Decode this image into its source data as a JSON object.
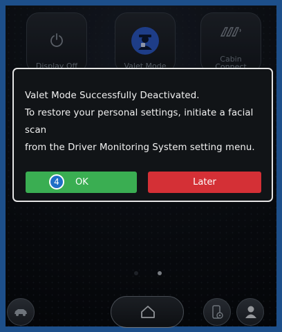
{
  "tiles": {
    "display_off": "Display Off",
    "valet_mode": "Valet Mode",
    "cabin_connect_line1": "Cabin",
    "cabin_connect_line2": "Connect"
  },
  "dialog": {
    "line1": "Valet Mode Successfully Deactivated.",
    "line2": "To restore your personal settings, initiate a facial scan",
    "line3": "from the Driver Monitoring System setting menu.",
    "ok_label": "OK",
    "later_label": "Later",
    "step_badge": "4"
  },
  "pager": {
    "pages": 2,
    "active_page": 2
  },
  "colors": {
    "frame_border": "#1d4f8a",
    "ok_button": "#3aae52",
    "later_button": "#d43036",
    "badge": "#1f6fc6",
    "valet_icon": "#2f5fd0"
  },
  "icons": {
    "display_off": "power-icon",
    "valet_mode": "valet-person-icon",
    "cabin_connect": "seats-icon",
    "vehicle": "car-icon",
    "home": "home-icon",
    "phone_settings": "phone-gear-icon",
    "profile": "person-icon"
  }
}
